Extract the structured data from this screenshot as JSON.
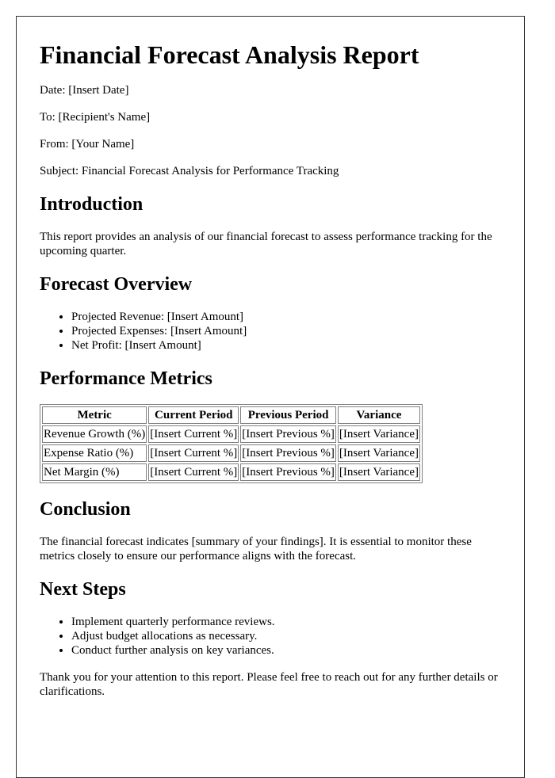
{
  "report": {
    "title": "Financial Forecast Analysis Report",
    "meta": {
      "date": "Date: [Insert Date]",
      "to": "To: [Recipient's Name]",
      "from": "From: [Your Name]",
      "subject": "Subject: Financial Forecast Analysis for Performance Tracking"
    },
    "introduction": {
      "heading": "Introduction",
      "text": "This report provides an analysis of our financial forecast to assess performance tracking for the upcoming quarter."
    },
    "forecast_overview": {
      "heading": "Forecast Overview",
      "items": [
        "Projected Revenue: [Insert Amount]",
        "Projected Expenses: [Insert Amount]",
        "Net Profit: [Insert Amount]"
      ]
    },
    "performance_metrics": {
      "heading": "Performance Metrics",
      "columns": [
        "Metric",
        "Current Period",
        "Previous Period",
        "Variance"
      ],
      "rows": [
        [
          "Revenue Growth (%)",
          "[Insert Current %]",
          "[Insert Previous %]",
          "[Insert Variance]"
        ],
        [
          "Expense Ratio (%)",
          "[Insert Current %]",
          "[Insert Previous %]",
          "[Insert Variance]"
        ],
        [
          "Net Margin (%)",
          "[Insert Current %]",
          "[Insert Previous %]",
          "[Insert Variance]"
        ]
      ]
    },
    "conclusion": {
      "heading": "Conclusion",
      "text": "The financial forecast indicates [summary of your findings]. It is essential to monitor these metrics closely to ensure our performance aligns with the forecast."
    },
    "next_steps": {
      "heading": "Next Steps",
      "items": [
        "Implement quarterly performance reviews.",
        "Adjust budget allocations as necessary.",
        "Conduct further analysis on key variances."
      ]
    },
    "closing": "Thank you for your attention to this report. Please feel free to reach out for any further details or clarifications."
  }
}
